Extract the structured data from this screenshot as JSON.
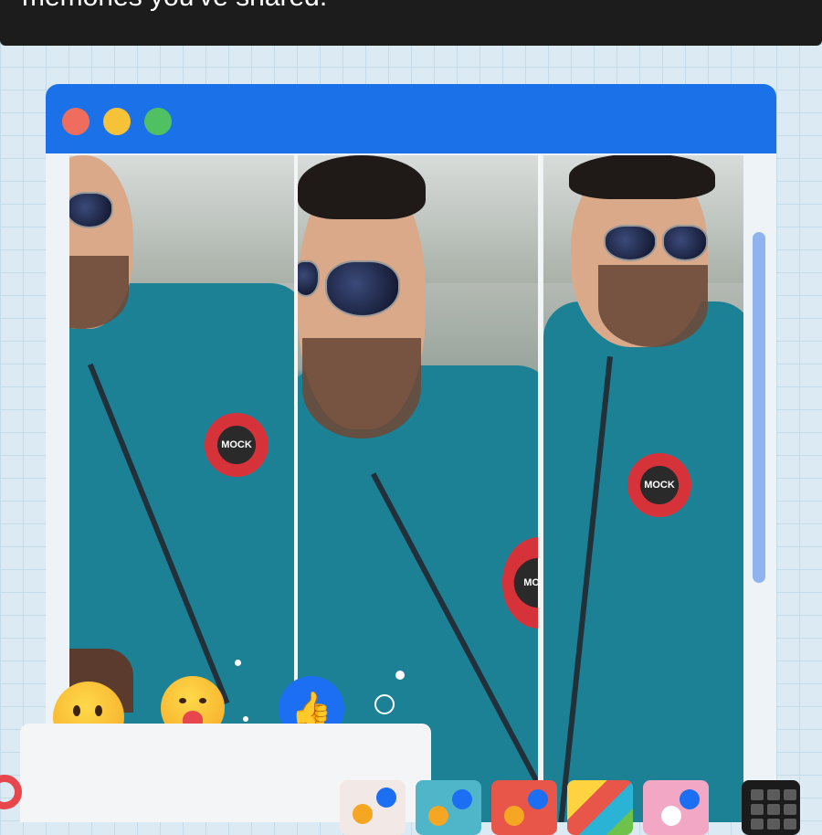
{
  "banner": {
    "text": "memories you've shared."
  },
  "window": {
    "controls": [
      "close",
      "minimize",
      "maximize"
    ],
    "accent": "#1b72e8"
  },
  "photos": [
    {
      "badge_text": "MOCK"
    },
    {
      "badge_text": "MOCK"
    },
    {
      "badge_text": "MOCK"
    }
  ],
  "reactions": [
    "wow-emoji",
    "care-emoji",
    "like-icon"
  ],
  "thumbnails": [
    "thumbnail-1",
    "thumbnail-2",
    "thumbnail-3",
    "thumbnail-4",
    "thumbnail-5"
  ],
  "colors": {
    "grid_bg": "#dceaf3",
    "like_blue": "#1c6ef2",
    "heart_red": "#e8464d",
    "jacket_teal": "#1d8196"
  }
}
